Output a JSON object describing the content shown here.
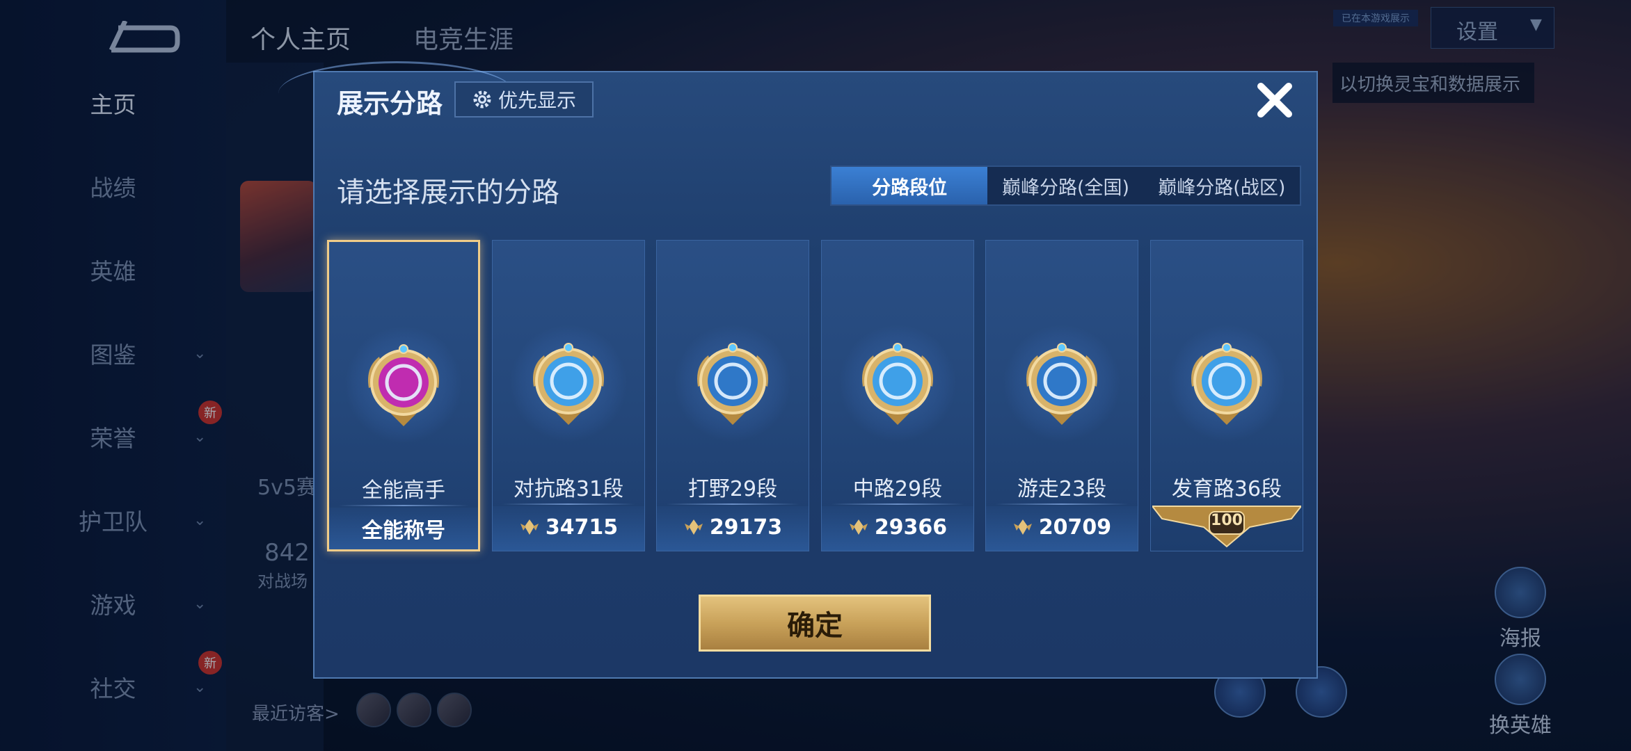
{
  "sidebar": {
    "items": [
      {
        "label": "主页",
        "active": true,
        "chevron": false,
        "is_new": false
      },
      {
        "label": "战绩",
        "active": false,
        "chevron": false,
        "is_new": false
      },
      {
        "label": "英雄",
        "active": false,
        "chevron": false,
        "is_new": false
      },
      {
        "label": "图鉴",
        "active": false,
        "chevron": true,
        "is_new": false
      },
      {
        "label": "荣誉",
        "active": false,
        "chevron": true,
        "is_new": true
      },
      {
        "label": "护卫队",
        "active": false,
        "chevron": true,
        "is_new": false
      },
      {
        "label": "游戏",
        "active": false,
        "chevron": true,
        "is_new": false
      },
      {
        "label": "社交",
        "active": false,
        "chevron": true,
        "is_new": true
      }
    ],
    "new_badge": "新"
  },
  "background": {
    "tabs": [
      "个人主页",
      "电竞生涯"
    ],
    "mode_text": "5v5赛",
    "count_text": "842",
    "count_label": "对战场",
    "visitors_label": "最近访客>",
    "hint": "以切换灵宝和数据展示",
    "settings_label": "设置",
    "small_tag": "已在本游戏展示",
    "right_buttons": [
      "海报",
      "换英雄"
    ]
  },
  "modal": {
    "title": "展示分路",
    "priority_label": "优先显示",
    "subtitle": "请选择展示的分路",
    "tabs": [
      {
        "label": "分路段位",
        "active": true
      },
      {
        "label": "巅峰分路(全国)",
        "active": false
      },
      {
        "label": "巅峰分路(战区)",
        "active": false
      }
    ],
    "cards": [
      {
        "label": "全能高手",
        "value": "全能称号",
        "type": "title",
        "selected": true,
        "badge_color": "#c02cb0"
      },
      {
        "label": "对抗路31段",
        "value": "34715",
        "type": "score",
        "selected": false,
        "badge_color": "#3fa0e8"
      },
      {
        "label": "打野29段",
        "value": "29173",
        "type": "score",
        "selected": false,
        "badge_color": "#2f78c8"
      },
      {
        "label": "中路29段",
        "value": "29366",
        "type": "score",
        "selected": false,
        "badge_color": "#3fa0e8"
      },
      {
        "label": "游走23段",
        "value": "20709",
        "type": "score",
        "selected": false,
        "badge_color": "#2f78c8"
      },
      {
        "label": "发育路36段",
        "value": "100",
        "type": "level",
        "selected": false,
        "badge_color": "#3fa0e8"
      }
    ],
    "confirm_label": "确定"
  },
  "colors": {
    "accent_blue": "#2a62ad",
    "gold": "#c9a25a",
    "selected_border": "#f0cc88"
  },
  "icons": [
    "back-arrow-icon",
    "gear-icon",
    "close-icon",
    "score-wing-icon",
    "chevron-down-icon"
  ]
}
